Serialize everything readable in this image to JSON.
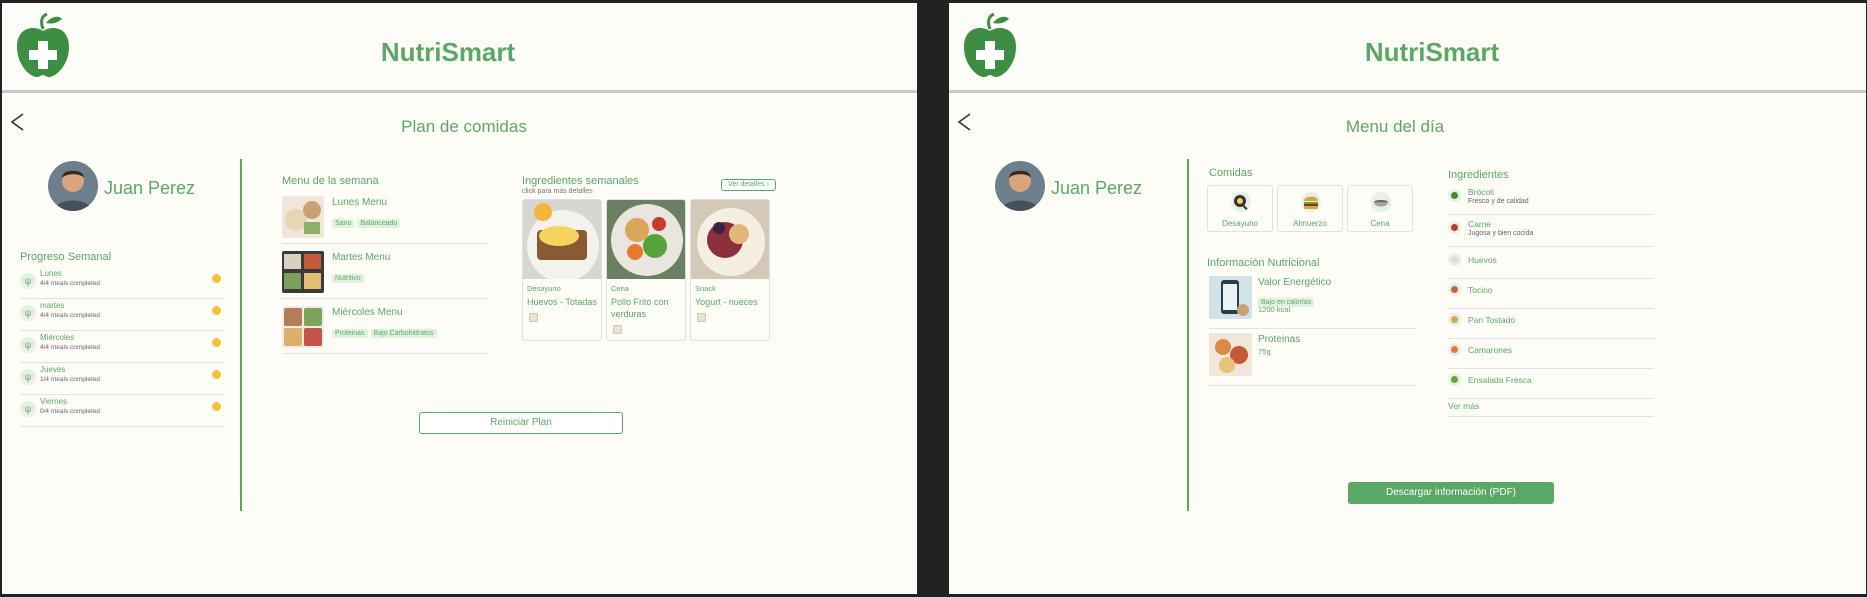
{
  "app": {
    "name": "NutriSmart"
  },
  "colors": {
    "primary": "#5aa866",
    "background": "#fdfcf7",
    "divider": "#c9c9c9"
  },
  "plan_screen": {
    "title": "Plan de comidas",
    "user_name": "Juan Perez",
    "progress": {
      "title": "Progreso Semanal",
      "days": [
        {
          "day": "Lunes",
          "status": "4/4 meals completed"
        },
        {
          "day": "martes",
          "status": "4/4 meals completed"
        },
        {
          "day": "Miércoles",
          "status": "4/4 meals completed"
        },
        {
          "day": "Jueves",
          "status": "1/4 meals completed"
        },
        {
          "day": "Viernes",
          "status": "0/4 meals completed"
        }
      ]
    },
    "week_menu": {
      "title": "Menu de la semana",
      "items": [
        {
          "name": "Lunes Menu",
          "tags": [
            "Sano",
            "Balanceado"
          ]
        },
        {
          "name": "Martes Menu",
          "tags": [
            "Nutritivo"
          ]
        },
        {
          "name": "Miércoles Menu",
          "tags": [
            "Proteinas",
            "Bajo Carbohidratos"
          ]
        }
      ]
    },
    "ingredients": {
      "title": "Ingredientes semanales",
      "hint": "click para más detalles",
      "details_link": "Ver detalles",
      "cards": [
        {
          "category": "Desayuno",
          "name": "Huevos - Totadas"
        },
        {
          "category": "Cena",
          "name": "Pollo Frito con verduras"
        },
        {
          "category": "Snack",
          "name": "Yogurt - nueces"
        }
      ]
    },
    "reset_button": "Reiniciar Plan"
  },
  "day_screen": {
    "title": "Menu del día",
    "user_name": "Juan Perez",
    "meals": {
      "title": "Comidas",
      "items": [
        {
          "label": "Desayuno",
          "icon": "frying-pan-icon"
        },
        {
          "label": "Almuerzo",
          "icon": "burger-icon"
        },
        {
          "label": "Cena",
          "icon": "bowl-icon"
        }
      ]
    },
    "nutrition": {
      "title": "Información Nutricional",
      "items": [
        {
          "name": "Valor Energético",
          "tag": "Bajo en calorías",
          "value": "1200 kcal"
        },
        {
          "name": "Proteinas",
          "value": "75g"
        }
      ]
    },
    "ingredients": {
      "title": "Ingredientes",
      "items": [
        {
          "name": "Brócoli",
          "desc": "Fresco y de calidad",
          "icon": "broccoli-icon",
          "color": "#3f8f2f"
        },
        {
          "name": "Carne",
          "desc": "Jugosa y bien cocida",
          "icon": "meat-icon",
          "color": "#c0392b"
        },
        {
          "name": "Huevos",
          "icon": "egg-icon",
          "color": "#e8e8e8"
        },
        {
          "name": "Tocino",
          "icon": "bacon-icon",
          "color": "#c8643b"
        },
        {
          "name": "Pan Tostado",
          "icon": "toast-icon",
          "color": "#d8a350"
        },
        {
          "name": "Camarones",
          "icon": "shrimp-icon",
          "color": "#e8743b"
        },
        {
          "name": "Ensalada Fresca",
          "icon": "salad-icon",
          "color": "#6aa33b"
        }
      ],
      "more_link": "Ver más"
    },
    "download_button": "Descargar información (PDF)"
  }
}
